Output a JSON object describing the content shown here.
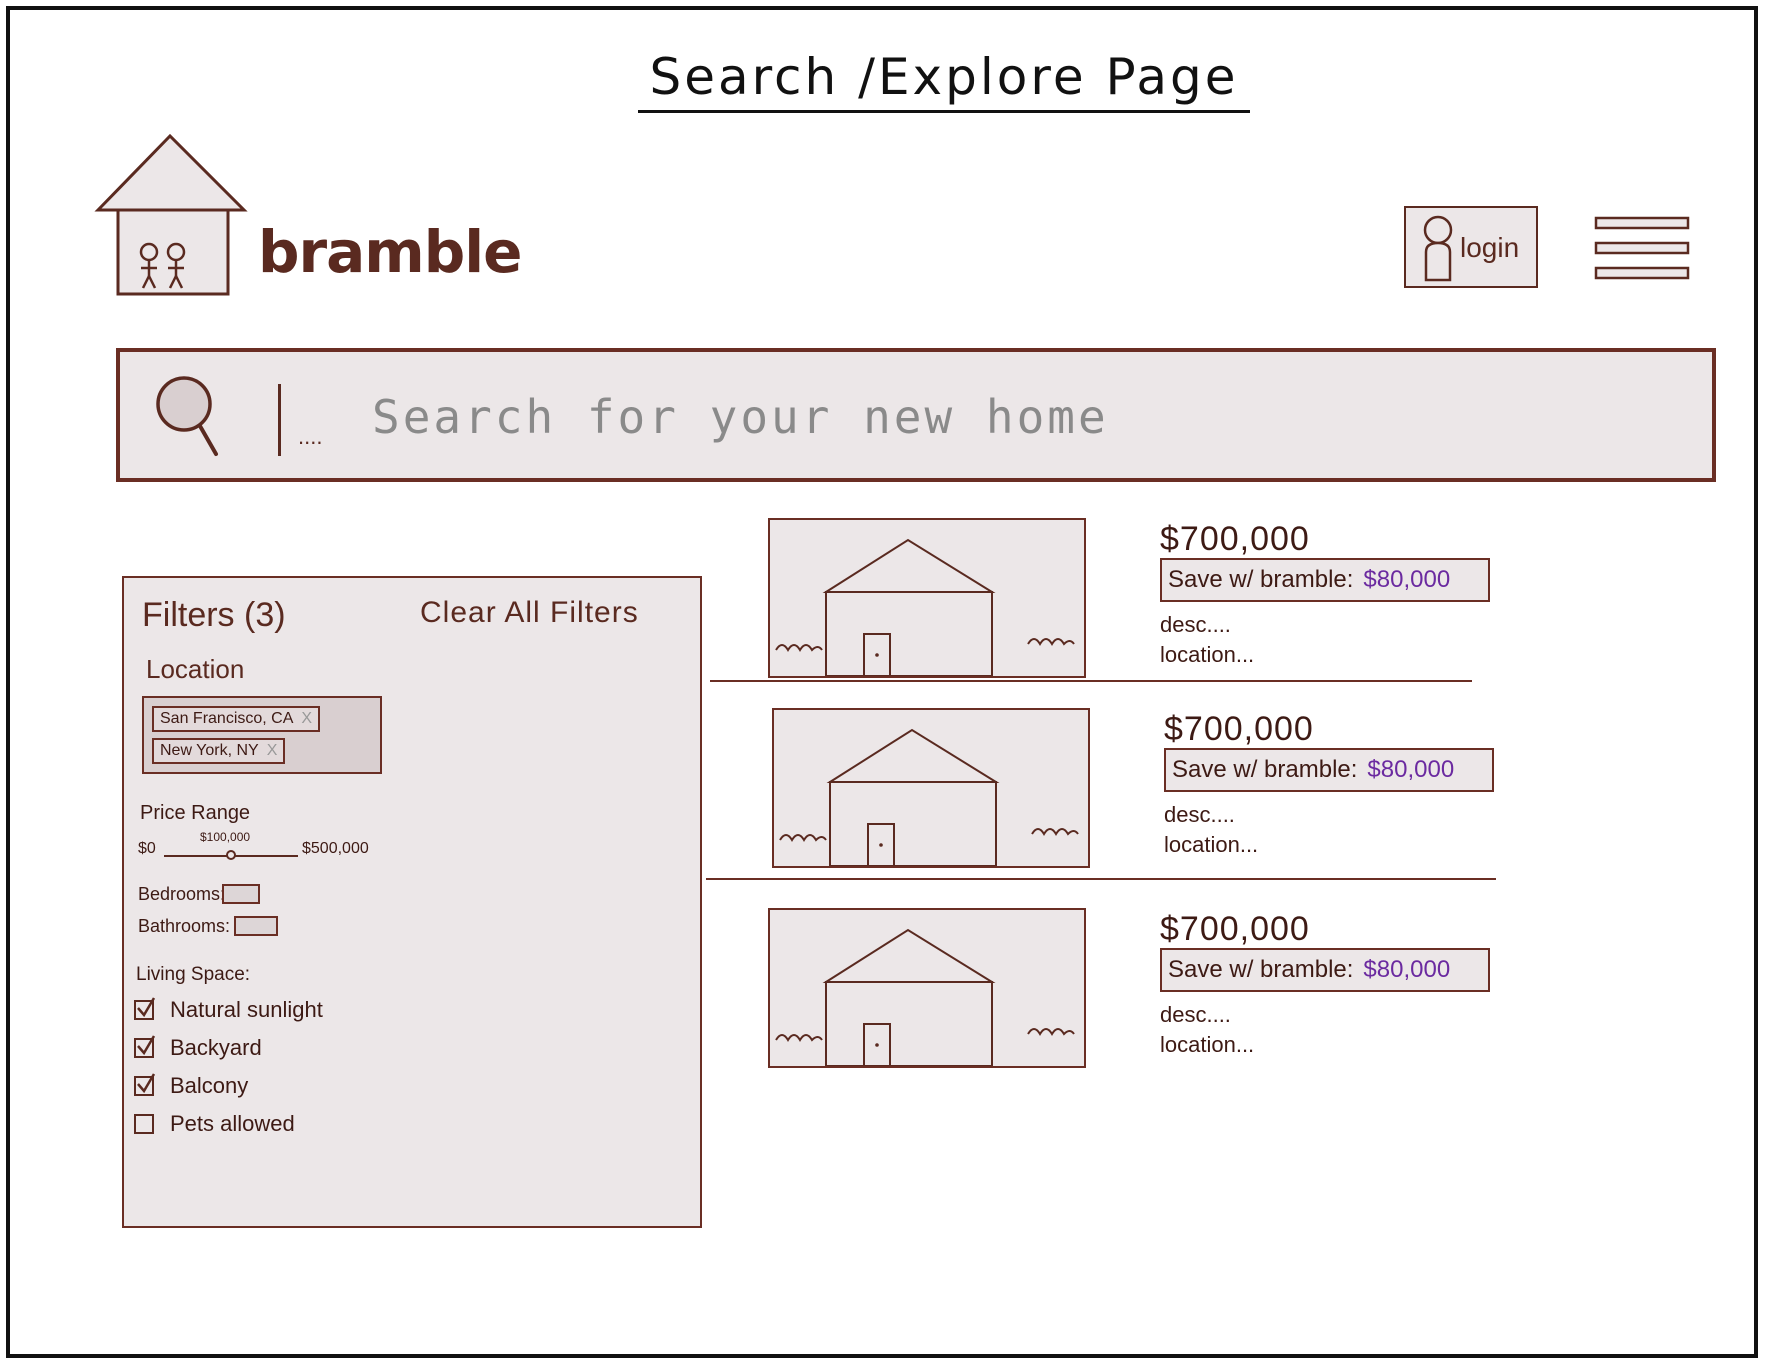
{
  "page": {
    "heading": "Search /Explore  Page"
  },
  "brand": {
    "name": "bramble"
  },
  "header": {
    "login_label": "login"
  },
  "search": {
    "placeholder": "Search for your new home",
    "value": ""
  },
  "filters": {
    "title": "Filters (3)",
    "clear_label": "Clear All Filters",
    "location": {
      "label": "Location",
      "chips": [
        {
          "label": "San Francisco, CA",
          "remove": "X"
        },
        {
          "label": "New York, NY",
          "remove": "X"
        }
      ]
    },
    "price": {
      "label": "Price Range",
      "min_label": "$0",
      "max_label": "$500,000",
      "current_label": "$100,000",
      "current_fraction": 0.5
    },
    "bedrooms_label": "Bedrooms:",
    "bathrooms_label": "Bathrooms:",
    "living_space": {
      "label": "Living Space:",
      "options": [
        {
          "label": "Natural sunlight",
          "checked": true
        },
        {
          "label": "Backyard",
          "checked": true
        },
        {
          "label": "Balcony",
          "checked": true
        },
        {
          "label": "Pets allowed",
          "checked": false
        }
      ]
    }
  },
  "listings": [
    {
      "price": "$700,000",
      "save_label": "Save w/ bramble:",
      "save_amount": "$80,000",
      "desc": "desc....",
      "location": "location..."
    },
    {
      "price": "$700,000",
      "save_label": "Save w/ bramble:",
      "save_amount": "$80,000",
      "desc": "desc....",
      "location": "location..."
    },
    {
      "price": "$700,000",
      "save_label": "Save w/ bramble:",
      "save_amount": "$80,000",
      "desc": "desc....",
      "location": "location..."
    }
  ],
  "colors": {
    "ink": "#5a2a20",
    "panel": "#ece7e8",
    "accent": "#6b2aa0"
  }
}
